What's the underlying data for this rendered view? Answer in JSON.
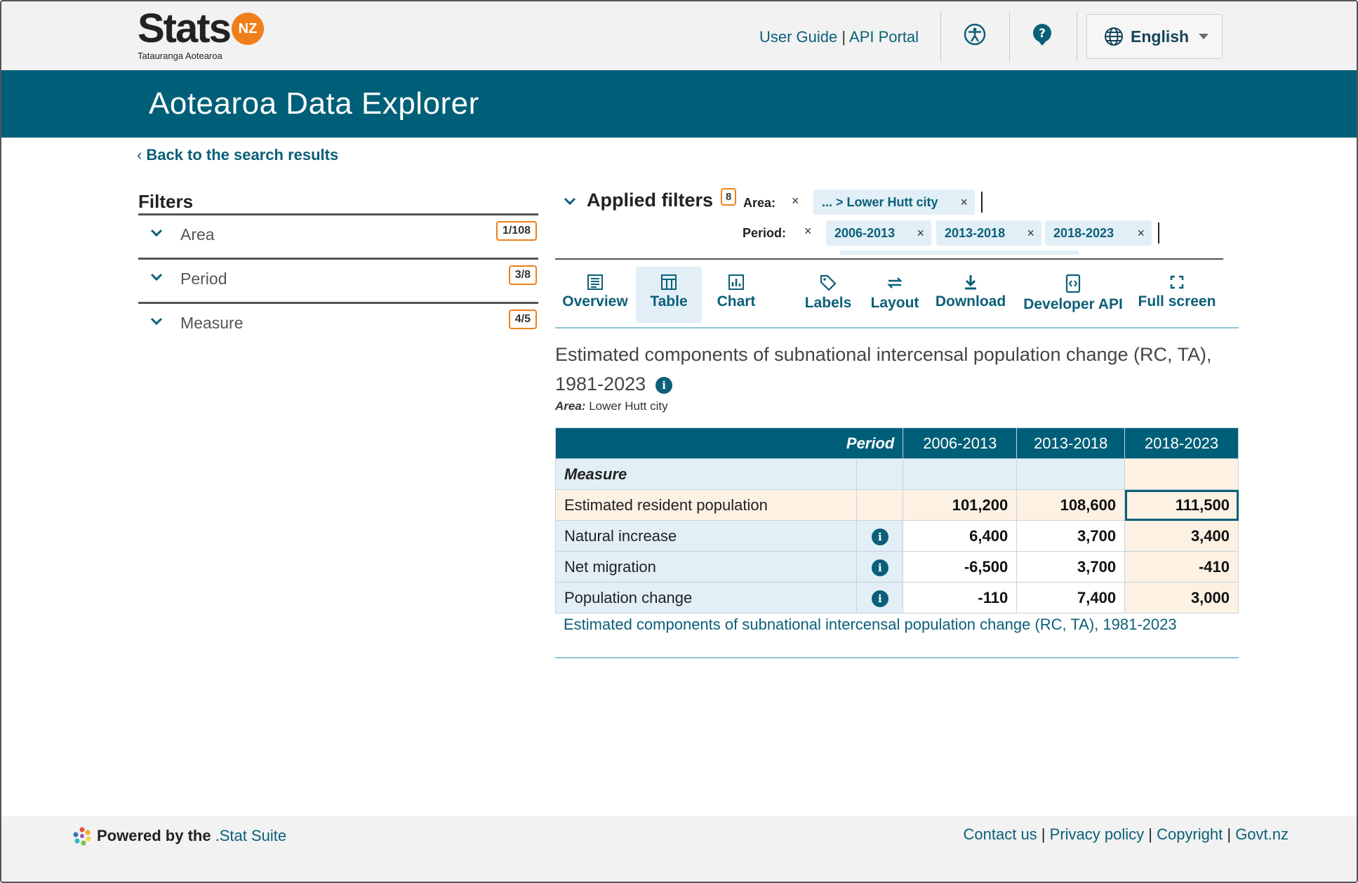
{
  "header": {
    "logo_word": "Stats",
    "logo_badge": "NZ",
    "logo_sub": "Tatauranga Aotearoa",
    "user_guide": "User Guide",
    "separator": " | ",
    "api_portal": "API Portal",
    "language": "English"
  },
  "banner": {
    "title": "Aotearoa Data Explorer"
  },
  "nav": {
    "back_label": "Back to the search results"
  },
  "filters": {
    "title": "Filters",
    "items": [
      {
        "label": "Area",
        "badge": "1/108"
      },
      {
        "label": "Period",
        "badge": "3/8"
      },
      {
        "label": "Measure",
        "badge": "4/5"
      }
    ]
  },
  "applied": {
    "title": "Applied filters",
    "count": "8",
    "area_label": "Area:",
    "area_chip": "... > Lower Hutt city",
    "period_label": "Period:",
    "period_chips": [
      "2006-2013",
      "2013-2018",
      "2018-2023"
    ],
    "remove_glyph": "×"
  },
  "toolbar": {
    "overview": "Overview",
    "table": "Table",
    "chart": "Chart",
    "labels": "Labels",
    "layout": "Layout",
    "download": "Download",
    "developer_api": "Developer API",
    "full_screen": "Full screen"
  },
  "table": {
    "title": "Estimated components of subnational intercensal population change (RC, TA), 1981-2023",
    "subtitle_key": "Area:",
    "subtitle_value": "Lower Hutt city",
    "period_header": "Period",
    "measure_header": "Measure",
    "periods": [
      "2006-2013",
      "2013-2018",
      "2018-2023"
    ],
    "rows": [
      {
        "label": "Estimated resident population",
        "values": [
          "101,200",
          "108,600",
          "111,500"
        ]
      },
      {
        "label": "Natural increase",
        "values": [
          "6,400",
          "3,700",
          "3,400"
        ]
      },
      {
        "label": "Net migration",
        "values": [
          "-6,500",
          "3,700",
          "-410"
        ]
      },
      {
        "label": "Population change",
        "values": [
          "-110",
          "7,400",
          "3,000"
        ]
      }
    ],
    "caption": "Estimated components of subnational intercensal population change (RC, TA), 1981-2023",
    "info_glyph": "i"
  },
  "footer": {
    "powered_prefix": "Powered by the",
    "powered_suite": ".Stat Suite",
    "contact": "Contact us",
    "privacy": "Privacy policy",
    "copyright": "Copyright",
    "govt": "Govt.nz",
    "sep": " | "
  },
  "colors": {
    "brand_teal": "#005f78",
    "link": "#0b5f78",
    "accent_orange": "#ef7f1a",
    "highlight": "#fcf1e3",
    "row_header_bg": "#e2eff6"
  }
}
